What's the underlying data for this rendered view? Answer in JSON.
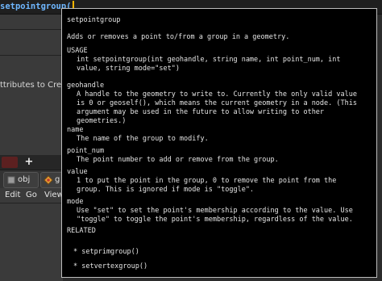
{
  "editor": {
    "code": "setpointgroup("
  },
  "left_panel": {
    "label": "ttributes to Create",
    "tab_add": "+",
    "path_obj": "obj",
    "path_next": "g",
    "menu": [
      "Edit",
      "Go",
      "View"
    ]
  },
  "tooltip": {
    "title": "setpointgroup",
    "summary": "Adds or removes a point to/from a group in a geometry.",
    "usage_heading": "USAGE",
    "usage_lines": [
      "int setpointgroup(int geohandle, string name, int point_num, int",
      "value, string mode=\"set\")"
    ],
    "params": [
      {
        "name": "geohandle",
        "lines": [
          "A handle to the geometry to write to. Currently the only valid value",
          "is 0 or geoself(), which means the current geometry in a node. (This",
          "argument may be used in the future to allow writing to other",
          "geometries.)"
        ]
      },
      {
        "name": "name",
        "lines": [
          "The name of the group to modify."
        ]
      },
      {
        "name": "point_num",
        "lines": [
          "The point number to add or remove from the group."
        ]
      },
      {
        "name": "value",
        "lines": [
          "1 to put the point in the group, 0 to remove the point from the",
          "group. This is ignored if mode is \"toggle\"."
        ]
      },
      {
        "name": "mode",
        "lines": [
          "Use \"set\" to set the point's membership according to the value. Use",
          "\"toggle\" to toggle the point's membership, regardless of the value."
        ]
      }
    ],
    "related_heading": "RELATED",
    "related": [
      "* setprimgroup()",
      "* setvertexgroup()"
    ]
  }
}
